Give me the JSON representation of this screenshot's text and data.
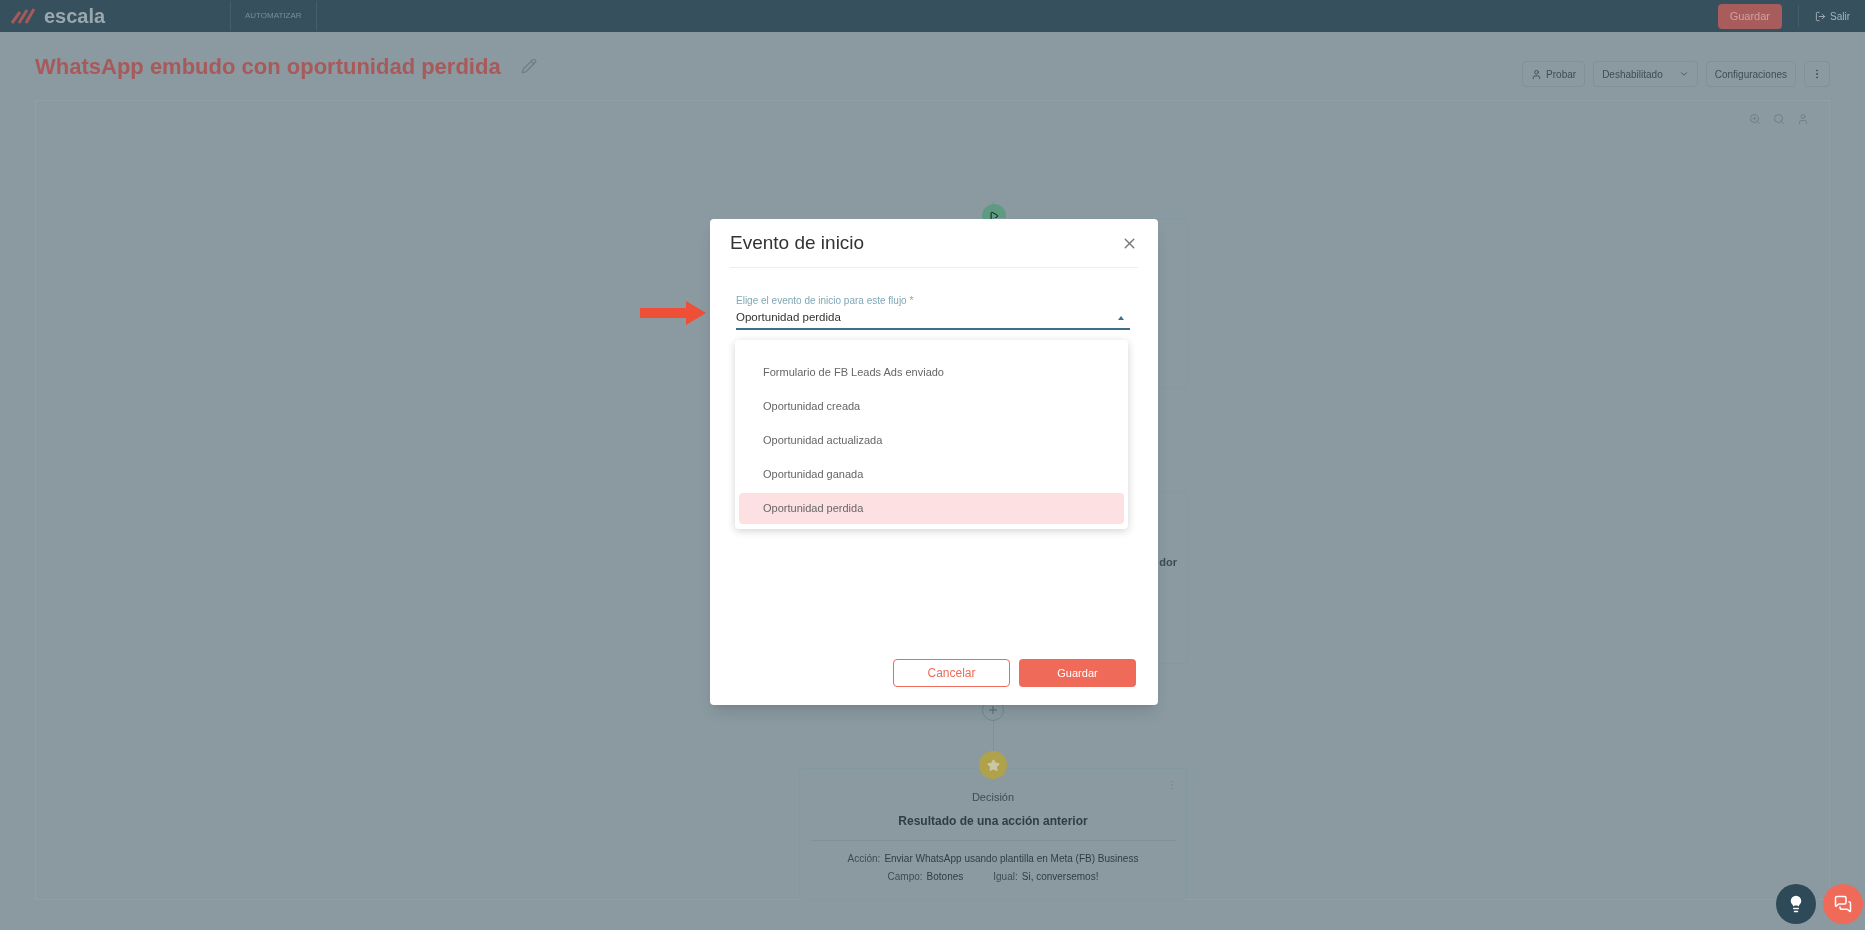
{
  "topbar": {
    "logo": "escala",
    "section": "AUTOMATIZAR",
    "save": "Guardar",
    "exit": "Salir"
  },
  "header": {
    "title": "WhatsApp embudo con oportunidad perdida",
    "buttons": [
      {
        "label": "Probar",
        "kind": "test"
      },
      {
        "label": "Deshabilitado",
        "kind": "dropdown"
      },
      {
        "label": "Configuraciones",
        "kind": "plain"
      }
    ]
  },
  "canvas": {
    "partial_text": "dor",
    "decision": {
      "type": "Decisión",
      "title": "Resultado de una acción anterior",
      "rows": [
        [
          {
            "label": "Acción:",
            "value": "Enviar WhatsApp usando plantilla en Meta (FB) Business"
          }
        ],
        [
          {
            "label": "Campo:",
            "value": "Botones"
          },
          {
            "label": "Igual:",
            "value": "Si, conversemos!"
          }
        ]
      ]
    }
  },
  "modal": {
    "title": "Evento de inicio",
    "field": {
      "label": "Elige el evento de inicio para este flujo *",
      "value": "Oportunidad perdida"
    },
    "options": [
      {
        "label": "Formulario de FB Leads Ads enviado",
        "selected": false
      },
      {
        "label": "Oportunidad creada",
        "selected": false
      },
      {
        "label": "Oportunidad actualizada",
        "selected": false
      },
      {
        "label": "Oportunidad ganada",
        "selected": false
      },
      {
        "label": "Oportunidad perdida",
        "selected": true
      }
    ],
    "cancel": "Cancelar",
    "save": "Guardar"
  }
}
